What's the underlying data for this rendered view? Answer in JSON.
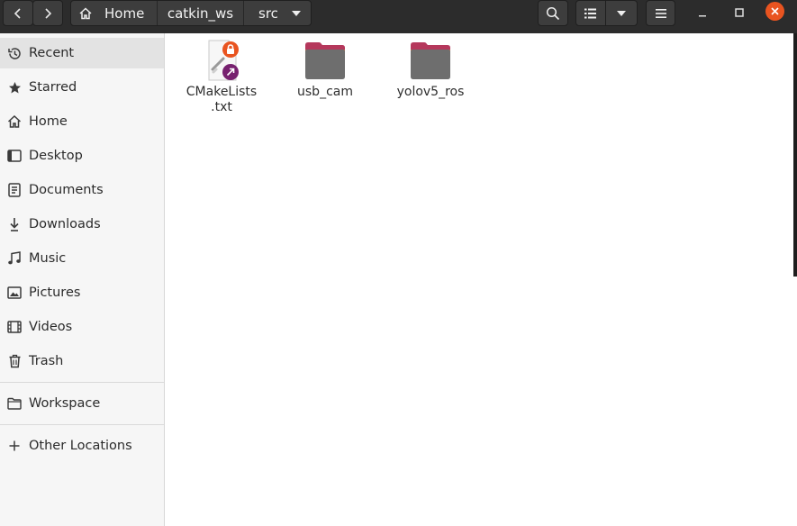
{
  "window": {
    "breadcrumb": [
      {
        "label": "Home"
      },
      {
        "label": "catkin_ws"
      },
      {
        "label": "src"
      }
    ]
  },
  "sidebar": {
    "items": [
      {
        "label": "Recent",
        "icon": "clock-icon"
      },
      {
        "label": "Starred",
        "icon": "star-icon"
      },
      {
        "label": "Home",
        "icon": "home-icon"
      },
      {
        "label": "Desktop",
        "icon": "desktop-icon"
      },
      {
        "label": "Documents",
        "icon": "document-icon"
      },
      {
        "label": "Downloads",
        "icon": "download-icon"
      },
      {
        "label": "Music",
        "icon": "music-icon"
      },
      {
        "label": "Pictures",
        "icon": "picture-icon"
      },
      {
        "label": "Videos",
        "icon": "video-icon"
      },
      {
        "label": "Trash",
        "icon": "trash-icon"
      }
    ],
    "bookmarks": [
      {
        "label": "Workspace",
        "icon": "folder-icon"
      }
    ],
    "other": {
      "label": "Other Locations",
      "icon": "plus-icon"
    }
  },
  "files": [
    {
      "name": "CMakeLists.txt",
      "line1": "CMakeLists",
      "line2": ".txt",
      "type": "text-file-link-locked"
    },
    {
      "name": "usb_cam",
      "type": "folder"
    },
    {
      "name": "yolov5_ros",
      "type": "folder"
    }
  ],
  "colors": {
    "headerbar": "#2c2c2c",
    "accent": "#e95420",
    "folder_tab": "#b5385c",
    "folder_body": "#6e6e6e",
    "link_badge": "#77216f"
  }
}
